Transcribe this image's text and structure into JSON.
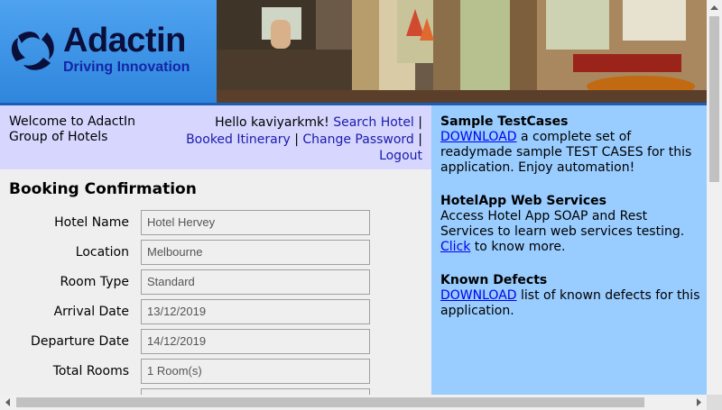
{
  "brand": {
    "title": "Adactin",
    "tagline": "Driving Innovation"
  },
  "welcome": {
    "text": "Welcome to AdactIn Group of Hotels"
  },
  "user_nav": {
    "greeting": "Hello kaviyarkmk!",
    "search_hotel": "Search Hotel",
    "booked_itinerary": "Booked Itinerary",
    "change_password": "Change Password",
    "logout": "Logout",
    "separator": "|"
  },
  "booking": {
    "title": "Booking Confirmation",
    "fields": [
      {
        "label": "Hotel Name",
        "value": "Hotel Hervey"
      },
      {
        "label": "Location",
        "value": "Melbourne"
      },
      {
        "label": "Room Type",
        "value": "Standard"
      },
      {
        "label": "Arrival Date",
        "value": "13/12/2019"
      },
      {
        "label": "Departure Date",
        "value": "14/12/2019"
      },
      {
        "label": "Total Rooms",
        "value": "1 Room(s)"
      }
    ]
  },
  "sidebar": {
    "sample_testcases": {
      "title": "Sample TestCases",
      "link": "DOWNLOAD",
      "text": " a complete set of readymade sample TEST CASES for this application. Enjoy automation!"
    },
    "web_services": {
      "title": "HotelApp Web Services",
      "text_before": "Access Hotel App SOAP and Rest Services to learn web services testing. ",
      "link": "Click",
      "text_after": " to know more."
    },
    "known_defects": {
      "title": "Known Defects",
      "link": "DOWNLOAD",
      "text": " list of known defects for this application."
    }
  },
  "colors": {
    "header_blue": "#3f96ea",
    "welcome_bg": "#d6d6ff",
    "content_bg": "#efefef",
    "sidebar_bg": "#99ccff",
    "nav_link": "#1b1bad"
  }
}
